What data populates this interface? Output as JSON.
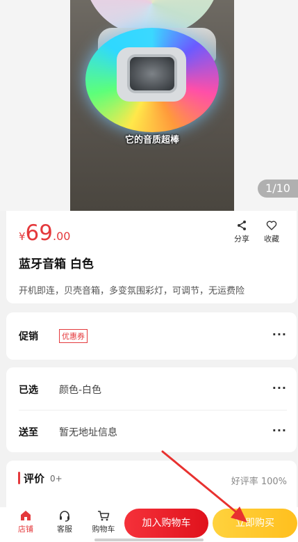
{
  "gallery": {
    "caption": "它的音质超棒",
    "counter": "1/10"
  },
  "product": {
    "currency": "¥",
    "price_int": "69",
    "price_dec": ".00",
    "title": "蓝牙音箱 白色",
    "description": "开机即连，贝壳音箱，多变氛围彩灯，可调节，无运费险",
    "share_label": "分享",
    "favorite_label": "收藏"
  },
  "promotion": {
    "label": "促销",
    "coupon": "优惠券",
    "more": "···"
  },
  "selection": {
    "selected_label": "已选",
    "selected_value": "颜色-白色",
    "delivery_label": "送至",
    "delivery_value": "暂无地址信息",
    "more": "···"
  },
  "reviews": {
    "title": "评价",
    "count": "0+",
    "good_rate": "好评率 100%"
  },
  "bottom_bar": {
    "store_label": "店铺",
    "service_label": "客服",
    "cart_label": "购物车",
    "add_to_cart": "加入购物车",
    "buy_now": "立即购买"
  },
  "colors": {
    "accent": "#e4393c",
    "buy_button": "#ffc62b",
    "annotation_arrow": "#e8312f"
  },
  "icons": [
    "share-icon",
    "heart-icon",
    "store-icon",
    "headset-icon",
    "cart-icon"
  ]
}
